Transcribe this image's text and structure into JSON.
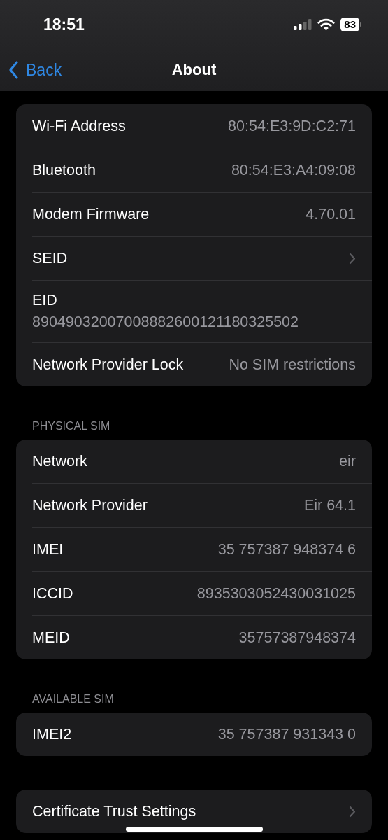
{
  "status_bar": {
    "time": "18:51",
    "battery": "83"
  },
  "nav": {
    "back": "Back",
    "title": "About"
  },
  "sections": [
    {
      "rows": [
        {
          "kind": "value",
          "label": "Wi-Fi Address",
          "value": "80:54:E3:9D:C2:71"
        },
        {
          "kind": "value",
          "label": "Bluetooth",
          "value": "80:54:E3:A4:09:08"
        },
        {
          "kind": "value",
          "label": "Modem Firmware",
          "value": "4.70.01"
        },
        {
          "kind": "link",
          "label": "SEID"
        },
        {
          "kind": "stacked",
          "label": "EID",
          "value": "89049032007008882600121180325502"
        },
        {
          "kind": "value",
          "label": "Network Provider Lock",
          "value": "No SIM restrictions"
        }
      ]
    },
    {
      "header": "PHYSICAL SIM",
      "rows": [
        {
          "kind": "value",
          "label": "Network",
          "value": "eir"
        },
        {
          "kind": "value",
          "label": "Network Provider",
          "value": "Eir 64.1"
        },
        {
          "kind": "value",
          "label": "IMEI",
          "value": "35 757387 948374 6"
        },
        {
          "kind": "value",
          "label": "ICCID",
          "value": "8935303052430031025"
        },
        {
          "kind": "value",
          "label": "MEID",
          "value": "35757387948374"
        }
      ]
    },
    {
      "header": "AVAILABLE SIM",
      "rows": [
        {
          "kind": "value",
          "label": "IMEI2",
          "value": "35 757387 931343 0"
        }
      ]
    },
    {
      "rows": [
        {
          "kind": "link",
          "label": "Certificate Trust Settings"
        }
      ]
    }
  ]
}
